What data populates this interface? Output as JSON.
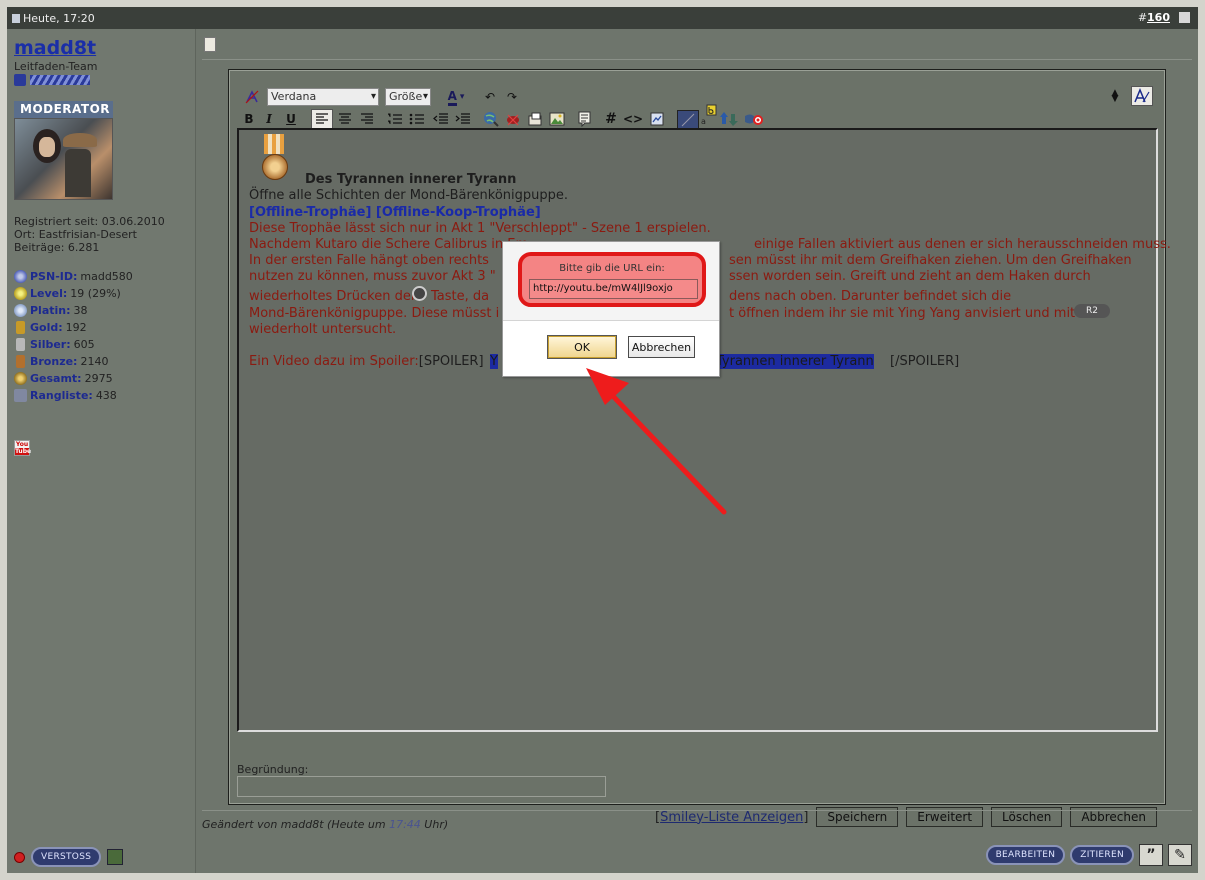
{
  "topbar": {
    "date": "Heute, 17:20",
    "hash": "#",
    "post_number": "160"
  },
  "user": {
    "name": "madd8t",
    "role": "Leitfaden-Team",
    "badge": "MODERATOR",
    "registered": "Registriert seit: 03.06.2010",
    "location": "Ort: Eastfrisian-Desert",
    "posts": "Beiträge: 6.281",
    "stats": [
      {
        "label": "PSN-ID:",
        "value": "madd580",
        "icon": "psn-icon"
      },
      {
        "label": "Level:",
        "value": "19 (29%)",
        "icon": "level-icon"
      },
      {
        "label": "Platin:",
        "value": "38",
        "icon": "platinum-trophy-icon"
      },
      {
        "label": "Gold:",
        "value": "192",
        "icon": "gold-trophy-icon"
      },
      {
        "label": "Silber:",
        "value": "605",
        "icon": "silver-trophy-icon"
      },
      {
        "label": "Bronze:",
        "value": "2140",
        "icon": "bronze-trophy-icon"
      },
      {
        "label": "Gesamt:",
        "value": "2975",
        "icon": "total-trophy-icon"
      },
      {
        "label": "Rangliste:",
        "value": "438",
        "icon": "ranking-icon"
      }
    ],
    "youtube_icon": "You Tube"
  },
  "footer_left": {
    "report_button": "VERSTOSS"
  },
  "toolbar": {
    "font": "Verdana",
    "size": "Größe",
    "text_color_glyph": "A",
    "bold": "B",
    "italic": "I",
    "underline": "U",
    "hash": "#",
    "code": "<>",
    "undo": "↶",
    "redo": "↷"
  },
  "post": {
    "heading": "Des Tyrannen innerer Tyrann",
    "line_desc": "Öffne alle Schichten der Mond-Bärenkönigpuppe.",
    "line_tags": "[Offline-Trophäe] [Offline-Koop-Trophäe]",
    "line_1": "Diese Trophäe lässt sich nur in Akt 1 \"Verschleppt\" - Szene 1 erspielen.",
    "line_2a": "Nachdem Kutaro die Schere Calibrus in Em",
    "line_2b": "einige Fallen aktiviert aus denen er sich herausschneiden muss.",
    "line_3a": "In der ersten Falle hängt oben rechts",
    "line_3b": "sen müsst ihr mit dem Greifhaken ziehen. Um den Greifhaken",
    "line_4a": "nutzen zu können, muss zuvor Akt 3 \"",
    "line_4b": "ssen worden sein. Greift und zieht an dem Haken durch",
    "line_5a": "wiederholtes Drücken der",
    "line_5b": "Taste, da",
    "line_5c": "dens nach oben. Darunter befindet sich die",
    "line_6a": "Mond-Bärenkönigpuppe. Diese müsst i",
    "line_6b": "t öffnen indem ihr sie mit Ying Yang anvisiert und mit",
    "line_6_button": "R2",
    "line_7": "wiederholt untersucht.",
    "line_8a": "Ein Video dazu im Spoiler:",
    "line_8b": "[SPOILER]",
    "line_8c": "Y",
    "line_8d": "Tyrannen innerer Tyrann",
    "line_8e": "[/SPOILER]"
  },
  "form": {
    "reason_label": "Begründung:",
    "smiley_pre": "[",
    "smiley_link": "Smiley-Liste Anzeigen",
    "smiley_post": "]",
    "save": "Speichern",
    "advanced": "Erweitert",
    "delete": "Löschen",
    "cancel": "Abbrechen"
  },
  "edited": {
    "prefix": "Geändert von madd8t (Heute um",
    "time": "17:44",
    "suffix": "Uhr)"
  },
  "footer_right": {
    "edit": "BEARBEITEN",
    "quote": "ZITIEREN"
  },
  "dialog": {
    "prompt": "Bitte gib die URL ein:",
    "url_value": "http://youtu.be/mW4lJl9oxjo",
    "ok": "OK",
    "cancel": "Abbrechen"
  },
  "colors": {
    "highlight": "#e01818",
    "link": "#1a2aa8",
    "text_red": "#8b1a10"
  }
}
